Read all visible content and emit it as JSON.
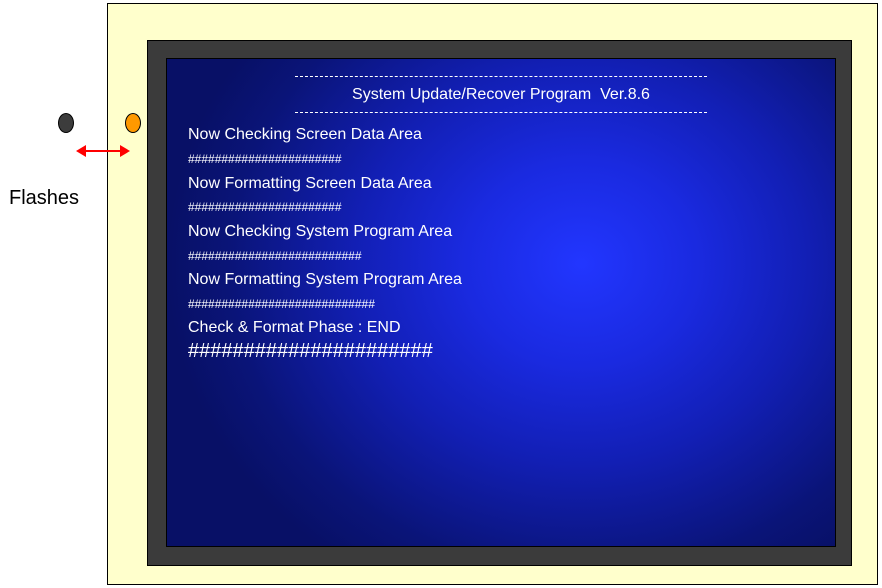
{
  "screen": {
    "title": "System Update/Recover Program  Ver.8.6",
    "dash_line": "-----------------------------------------------------------",
    "lines": [
      "Now Checking Screen Data Area",
      "#######################",
      "Now Formatting Screen Data Area",
      "#######################",
      "Now Checking System Program Area",
      "##########################",
      "Now Formatting System Program Area",
      "############################",
      "Check & Format Phase : END",
      "######################"
    ]
  },
  "indicator": {
    "label": "Flashes",
    "led_left_color": "#3c3c3c",
    "led_right_color": "#ff9900",
    "arrow_color": "#ff0000"
  }
}
